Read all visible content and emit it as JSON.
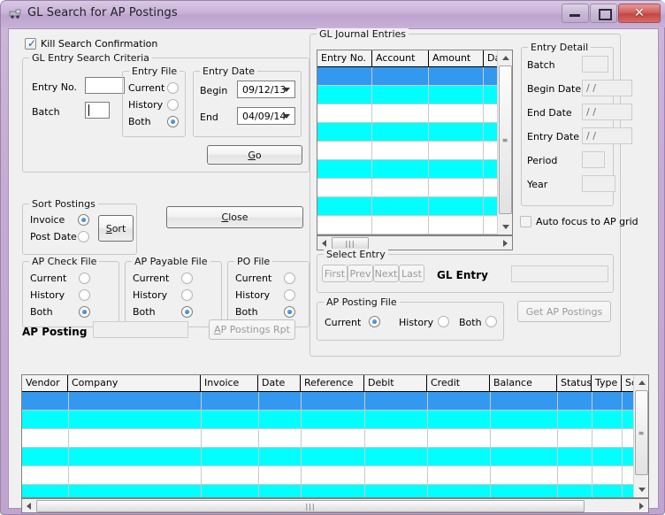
{
  "window": {
    "title": "GL Search for AP Postings",
    "icon": "app-icon",
    "minimize_label": "",
    "maximize_label": "",
    "close_label": "✕",
    "frame_color": "#c3abd1",
    "client_color": "#f0f0f0"
  },
  "kill_search": {
    "label": "Kill Search Confirmation",
    "checked": true
  },
  "search_criteria": {
    "legend": "GL Entry Search Criteria",
    "entry_no_label": "Entry No.",
    "entry_no_value": "",
    "batch_label": "Batch",
    "batch_value": "",
    "entry_file": {
      "legend": "Entry File",
      "options": [
        "Current",
        "History",
        "Both"
      ],
      "selected": "Both"
    },
    "entry_date": {
      "legend": "Entry Date",
      "begin_label": "Begin",
      "begin_value": "09/12/13",
      "end_label": "End",
      "end_value": "04/09/14"
    },
    "go_button": "Go",
    "go_accel": "G"
  },
  "sort_postings": {
    "legend": "Sort Postings",
    "options": [
      "Invoice",
      "Post Date"
    ],
    "selected": "Invoice",
    "sort_button": "Sort",
    "sort_accel": "S"
  },
  "close_button": {
    "label": "Close",
    "accel": "C"
  },
  "ap_check_file": {
    "legend": "AP Check File",
    "options": [
      "Current",
      "History",
      "Both"
    ],
    "selected": "Both"
  },
  "ap_payable_file": {
    "legend": "AP Payable File",
    "options": [
      "Current",
      "History",
      "Both"
    ],
    "selected": "Both"
  },
  "po_file": {
    "legend": "PO File",
    "options": [
      "Current",
      "History",
      "Both"
    ],
    "selected": "Both"
  },
  "ap_posting": {
    "label": "AP Posting",
    "value": "",
    "report_button": "AP Postings Rpt",
    "report_accel": "A"
  },
  "gl_journal": {
    "legend": "GL Journal Entries",
    "columns": [
      "Entry No.",
      "Account",
      "Amount",
      "Da"
    ],
    "rows": [
      {
        "style": "selected",
        "cells": [
          "",
          "",
          "",
          ""
        ]
      },
      {
        "style": "alt",
        "cells": [
          "",
          "",
          "",
          ""
        ]
      },
      {
        "style": "plain",
        "cells": [
          "",
          "",
          "",
          ""
        ]
      },
      {
        "style": "alt",
        "cells": [
          "",
          "",
          "",
          ""
        ]
      },
      {
        "style": "plain",
        "cells": [
          "",
          "",
          "",
          ""
        ]
      },
      {
        "style": "alt",
        "cells": [
          "",
          "",
          "",
          ""
        ]
      },
      {
        "style": "plain",
        "cells": [
          "",
          "",
          "",
          ""
        ]
      },
      {
        "style": "alt",
        "cells": [
          "",
          "",
          "",
          ""
        ]
      },
      {
        "style": "plain",
        "cells": [
          "",
          "",
          "",
          ""
        ]
      }
    ]
  },
  "entry_detail": {
    "legend": "Entry Detail",
    "fields": [
      {
        "label": "Batch",
        "value": ""
      },
      {
        "label": "Begin Date",
        "value": "/  /"
      },
      {
        "label": "End Date",
        "value": "/  /"
      },
      {
        "label": "Entry Date",
        "value": "/  /"
      },
      {
        "label": "Period",
        "value": ""
      },
      {
        "label": "Year",
        "value": ""
      }
    ]
  },
  "auto_focus": {
    "label": "Auto focus to AP grid",
    "checked": false
  },
  "select_entry": {
    "legend": "Select Entry",
    "buttons": [
      "First",
      "Prev",
      "Next",
      "Last"
    ],
    "gl_entry_label": "GL Entry",
    "gl_entry_value": ""
  },
  "ap_posting_file": {
    "legend": "AP Posting File",
    "options": [
      "Current",
      "History",
      "Both"
    ],
    "selected": "Current",
    "get_button": "Get AP Postings"
  },
  "ap_grid": {
    "columns": [
      "Vendor",
      "Company",
      "Invoice",
      "Date",
      "Reference",
      "Debit",
      "Credit",
      "Balance",
      "Status",
      "Type",
      "Sc"
    ],
    "rows": [
      {
        "style": "selected",
        "cells": [
          "",
          "",
          "",
          "",
          "",
          "",
          "",
          "",
          "",
          "",
          ""
        ]
      },
      {
        "style": "alt",
        "cells": [
          "",
          "",
          "",
          "",
          "",
          "",
          "",
          "",
          "",
          "",
          ""
        ]
      },
      {
        "style": "plain",
        "cells": [
          "",
          "",
          "",
          "",
          "",
          "",
          "",
          "",
          "",
          "",
          ""
        ]
      },
      {
        "style": "alt",
        "cells": [
          "",
          "",
          "",
          "",
          "",
          "",
          "",
          "",
          "",
          "",
          ""
        ]
      },
      {
        "style": "plain",
        "cells": [
          "",
          "",
          "",
          "",
          "",
          "",
          "",
          "",
          "",
          "",
          ""
        ]
      },
      {
        "style": "alt",
        "cells": [
          "",
          "",
          "",
          "",
          "",
          "",
          "",
          "",
          "",
          "",
          ""
        ]
      },
      {
        "style": "plain",
        "cells": [
          "",
          "",
          "",
          "",
          "",
          "",
          "",
          "",
          "",
          "",
          ""
        ]
      }
    ]
  },
  "colors": {
    "row_selected": "#3399f0",
    "row_alt": "#00ffff",
    "row_plain": "#ffffff",
    "header_bg": "#f3f3f3",
    "accent": "#1366b5"
  }
}
